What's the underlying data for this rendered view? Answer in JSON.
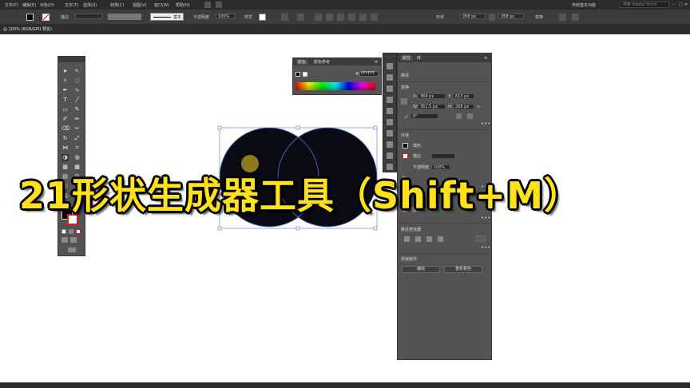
{
  "menu": {
    "items": [
      "文件(F)",
      "编辑(E)",
      "对象(O)",
      "文字(T)",
      "选择(S)",
      "效果(C)",
      "视图(V)",
      "窗口(W)",
      "帮助(H)"
    ],
    "workspace": "传统基本功能",
    "search_placeholder": "搜索 Adobe Stock"
  },
  "control_bar": {
    "stroke_label": "描边",
    "style_preset": "基本",
    "opacity_label": "不透明度",
    "opacity_value": "100%",
    "style_label": "样式",
    "shape_label": "形状",
    "w_value": "268 px",
    "h_value": "268 px",
    "transform_label": "变换"
  },
  "document_tab": {
    "label": "@ 100% (RGB/GPU 预览)"
  },
  "color_panel": {
    "tabs": [
      "颜色",
      "颜色参考"
    ],
    "hex_value": "FFFFFF"
  },
  "properties_panel": {
    "tabs": [
      "属性",
      "库"
    ],
    "section_path": "路径",
    "section_transform": "变换",
    "x": "369 px",
    "y": "613 px",
    "w": "351.5 px",
    "h": "268 px",
    "angle": "0°",
    "section_appearance": "外观",
    "fill_label": "填色",
    "stroke_label": "描边",
    "opacity_label": "不透明度",
    "opacity_value": "100%",
    "fx_label": "fx.",
    "section_align": "对齐",
    "section_pathfinder": "路径查找器",
    "section_quick": "快速操作",
    "btn_edit": "编组",
    "btn_recolor": "重新着色"
  },
  "overlay": {
    "title": "21形状生成器工具（Shift+M）"
  },
  "colors": {
    "menu_bg": "#2b2b2b",
    "panel_bg": "#535353",
    "circle_fill": "#0a0a12",
    "selection": "#5a6fd8",
    "title_yellow": "#ffe21a",
    "small_dot": "#8c7a1c"
  }
}
